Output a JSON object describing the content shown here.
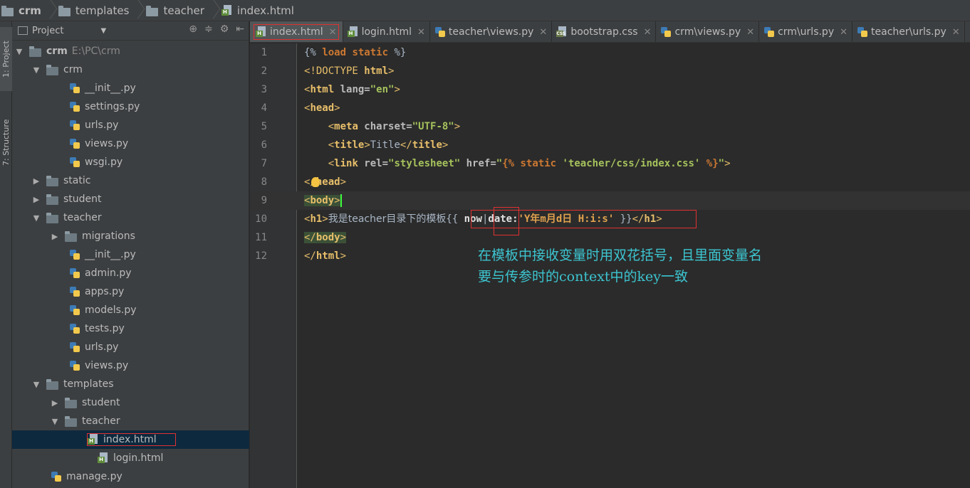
{
  "breadcrumb": [
    {
      "label": "crm",
      "icon": "folder-icon",
      "bold": true
    },
    {
      "label": "templates",
      "icon": "folder-icon"
    },
    {
      "label": "teacher",
      "icon": "folder-icon"
    },
    {
      "label": "index.html",
      "icon": "html-file-icon"
    }
  ],
  "toolstrip": {
    "project": "1: Project",
    "structure": "7: Structure"
  },
  "project_panel": {
    "title": "Project"
  },
  "tree": {
    "root": {
      "name": "crm",
      "path": "E:\\PC\\crm"
    },
    "items": [
      "crm",
      "__init__.py",
      "settings.py",
      "urls.py",
      "views.py",
      "wsgi.py",
      "static",
      "student",
      "teacher",
      "migrations",
      "__init__.py",
      "admin.py",
      "apps.py",
      "models.py",
      "tests.py",
      "urls.py",
      "views.py",
      "templates",
      "student",
      "teacher",
      "index.html",
      "login.html",
      "manage.py"
    ]
  },
  "tabs": [
    {
      "label": "index.html",
      "icon": "html-file-icon",
      "active": true
    },
    {
      "label": "login.html",
      "icon": "html-file-icon"
    },
    {
      "label": "teacher\\views.py",
      "icon": "python-file-icon"
    },
    {
      "label": "bootstrap.css",
      "icon": "css-file-icon"
    },
    {
      "label": "crm\\views.py",
      "icon": "python-file-icon"
    },
    {
      "label": "crm\\urls.py",
      "icon": "python-file-icon"
    },
    {
      "label": "teacher\\urls.py",
      "icon": "python-file-icon"
    }
  ],
  "editor": {
    "line_numbers": [
      "1",
      "2",
      "3",
      "4",
      "5",
      "6",
      "7",
      "8",
      "9",
      "10",
      "11",
      "12"
    ],
    "code": {
      "l1_open": "{% ",
      "l1_kw1": "load",
      "l1_kw2": " static",
      "l1_close": " %}",
      "l2_a": "<!DOCTYPE ",
      "l2_b": "html",
      "l2_c": ">",
      "l3_a": "<",
      "l3_tag": "html",
      "l3_attr": " lang=",
      "l3_str": "\"en\"",
      "l3_c": ">",
      "l4_a": "<",
      "l4_tag": "head",
      "l4_c": ">",
      "l5_indent": "    ",
      "l5_a": "<",
      "l5_tag": "meta",
      "l5_attr": " charset=",
      "l5_str": "\"UTF-8\"",
      "l5_c": ">",
      "l6_indent": "    ",
      "l6_a": "<",
      "l6_tag": "title",
      "l6_b": ">",
      "l6_text": "Title",
      "l6_c": "</",
      "l6_tag2": "title",
      "l6_d": ">",
      "l7_indent": "    ",
      "l7_a": "<",
      "l7_tag": "link",
      "l7_attr1": " rel=",
      "l7_str1": "\"stylesheet\"",
      "l7_attr2": " href=",
      "l7_q": "\"",
      "l7_tpl": "{% static ",
      "l7_path": "'teacher/css/index.css'",
      "l7_tpl2": " %}",
      "l7_q2": "\"",
      "l7_c": ">",
      "l8_a": "</",
      "l8_tag": "head",
      "l8_c": ">",
      "l9_a": "<",
      "l9_tag": "body",
      "l9_c": ">",
      "l10_a": "<",
      "l10_tag": "h1",
      "l10_b": ">",
      "l10_text": "我是teacher目录下的模板",
      "l10_open": "{{ ",
      "l10_var": "now",
      "l10_pipe": "|",
      "l10_filter": "date:",
      "l10_fmt": "'Y年m月d日 H:i:s'",
      "l10_close": " }}",
      "l10_c": "</",
      "l10_tag2": "h1",
      "l10_d": ">",
      "l11_a": "</",
      "l11_tag": "body",
      "l11_c": ">",
      "l12_a": "</",
      "l12_tag": "html",
      "l12_c": ">"
    },
    "annotation": [
      "在模板中接收变量时用双花括号，且里面变量名",
      "要与传参时的context中的key一致"
    ]
  }
}
